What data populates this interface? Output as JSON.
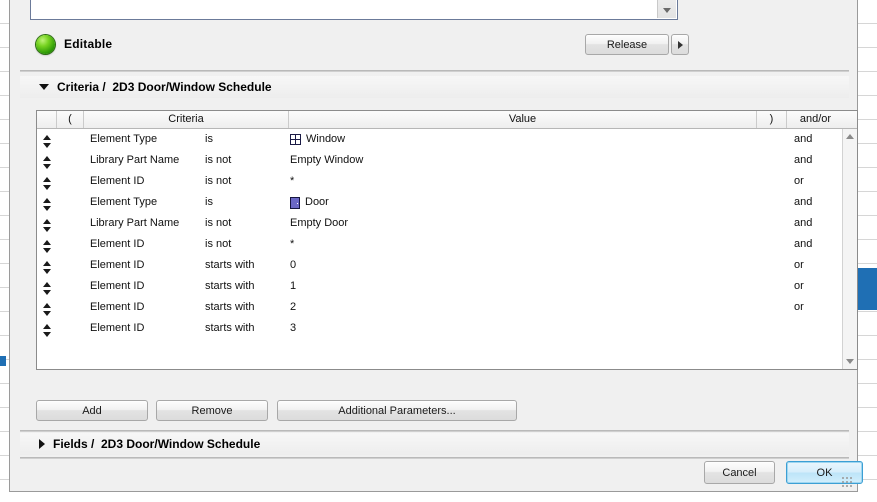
{
  "dialog": {
    "status": {
      "indicator": "green-led-icon",
      "label": "Editable"
    },
    "release_button": "Release",
    "release_more": "chevron-right-icon"
  },
  "criteria_section": {
    "arrow": "triangle-down-icon",
    "title": "Criteria /  2D3 Door/Window Schedule",
    "columns": {
      "handle": "",
      "open_paren": "(",
      "criteria": "Criteria",
      "value": "Value",
      "close_paren": ")",
      "andor": "and/or"
    },
    "rows": [
      {
        "handle": "drag-handle-icon",
        "field": "Element Type",
        "op": "is",
        "icon": "window-icon",
        "value": "Window",
        "andor": "and"
      },
      {
        "handle": "drag-handle-icon",
        "field": "Library Part Name",
        "op": "is not",
        "icon": "",
        "value": "Empty Window",
        "andor": "and"
      },
      {
        "handle": "drag-handle-icon",
        "field": "Element ID",
        "op": "is not",
        "icon": "",
        "value": "*",
        "andor": "or"
      },
      {
        "handle": "drag-handle-icon",
        "field": "Element Type",
        "op": "is",
        "icon": "door-icon",
        "value": "Door",
        "andor": "and"
      },
      {
        "handle": "drag-handle-icon",
        "field": "Library Part Name",
        "op": "is not",
        "icon": "",
        "value": "Empty Door",
        "andor": "and"
      },
      {
        "handle": "drag-handle-icon",
        "field": "Element ID",
        "op": "is not",
        "icon": "",
        "value": "*",
        "andor": "and"
      },
      {
        "handle": "drag-handle-icon",
        "field": "Element ID",
        "op": "starts with",
        "icon": "",
        "value": "0",
        "andor": "or"
      },
      {
        "handle": "drag-handle-icon",
        "field": "Element ID",
        "op": "starts with",
        "icon": "",
        "value": "1",
        "andor": "or"
      },
      {
        "handle": "drag-handle-icon",
        "field": "Element ID",
        "op": "starts with",
        "icon": "",
        "value": "2",
        "andor": "or"
      },
      {
        "handle": "drag-handle-icon",
        "field": "Element ID",
        "op": "starts with",
        "icon": "",
        "value": "3",
        "andor": ""
      }
    ],
    "buttons": {
      "add": "Add",
      "remove": "Remove",
      "additional_parameters": "Additional Parameters..."
    }
  },
  "fields_section": {
    "arrow": "triangle-right-icon",
    "title": "Fields /  2D3 Door/Window Schedule"
  },
  "footer": {
    "cancel": "Cancel",
    "ok": "OK"
  },
  "colors": {
    "status_green": "#4fbf12",
    "default_button_border": "#3c9fd4",
    "window_icon": "#1b1b46",
    "door_icon": "#6b68c6",
    "selection_blue": "#1f6fb4"
  }
}
